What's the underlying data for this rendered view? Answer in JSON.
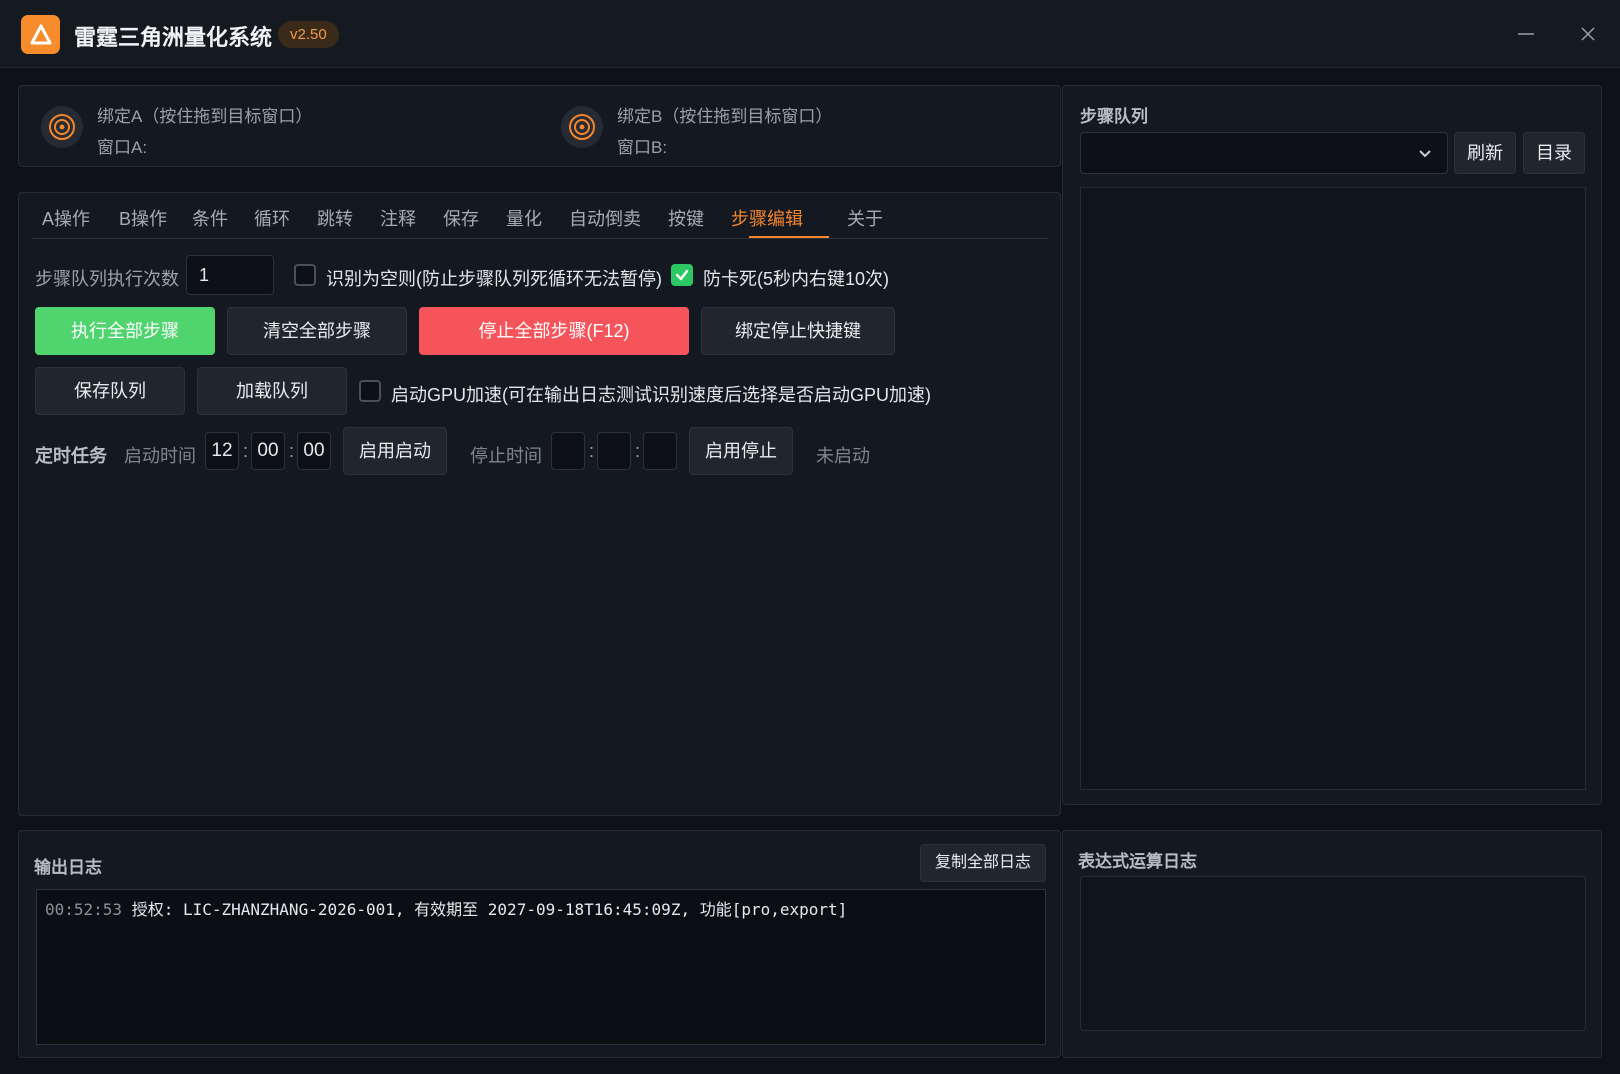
{
  "titlebar": {
    "app_title": "雷霆三角洲量化系统",
    "version": "v2.50",
    "logo_icon": "triangle-logo-icon",
    "accent_color": "#f68c2c"
  },
  "bind": {
    "a": {
      "title": "绑定A（按住拖到目标窗口）",
      "window_label": "窗口A:"
    },
    "b": {
      "title": "绑定B（按住拖到目标窗口）",
      "window_label": "窗口B:"
    }
  },
  "tabs": [
    "A操作",
    "B操作",
    "条件",
    "循环",
    "跳转",
    "注释",
    "保存",
    "量化",
    "自动倒卖",
    "按键",
    "步骤编辑",
    "关于"
  ],
  "active_tab": "步骤编辑",
  "step_edit": {
    "exec_count_label": "步骤队列执行次数",
    "exec_count_value": "1",
    "empty_rule_label": "识别为空则(防止步骤队列死循环无法暂停)",
    "empty_rule_checked": false,
    "anti_freeze_label": "防卡死(5秒内右键10次)",
    "anti_freeze_checked": true,
    "btn_run_all": "执行全部步骤",
    "btn_clear_all": "清空全部步骤",
    "btn_stop_all": "停止全部步骤(F12)",
    "btn_bind_stop": "绑定停止快捷键",
    "btn_save_queue": "保存队列",
    "btn_load_queue": "加载队列",
    "gpu_label": "启动GPU加速(可在输出日志测试识别速度后选择是否启动GPU加速)",
    "gpu_checked": false
  },
  "schedule": {
    "label": "定时任务",
    "start_label": "启动时间",
    "start_h": "12",
    "start_m": "00",
    "start_s": "00",
    "btn_enable_start": "启用启动",
    "stop_label": "停止时间",
    "stop_h": "",
    "stop_m": "",
    "stop_s": "",
    "btn_enable_stop": "启用停止",
    "status": "未启动"
  },
  "queue": {
    "heading": "步骤队列",
    "selected": "",
    "btn_refresh": "刷新",
    "btn_directory": "目录"
  },
  "log": {
    "heading": "输出日志",
    "btn_copy": "复制全部日志",
    "entries": [
      {
        "time": "00:52:53",
        "message": "授权: LIC-ZHANZHANG-2026-001, 有效期至 2027-09-18T16:45:09Z, 功能[pro,export]"
      }
    ]
  },
  "expr_log": {
    "heading": "表达式运算日志"
  },
  "colors": {
    "background": "#0e1117",
    "panel": "#141820",
    "accent_orange": "#f5862c",
    "run_green": "#4fd46e",
    "stop_red": "#f5545a",
    "check_green": "#2dc864"
  }
}
